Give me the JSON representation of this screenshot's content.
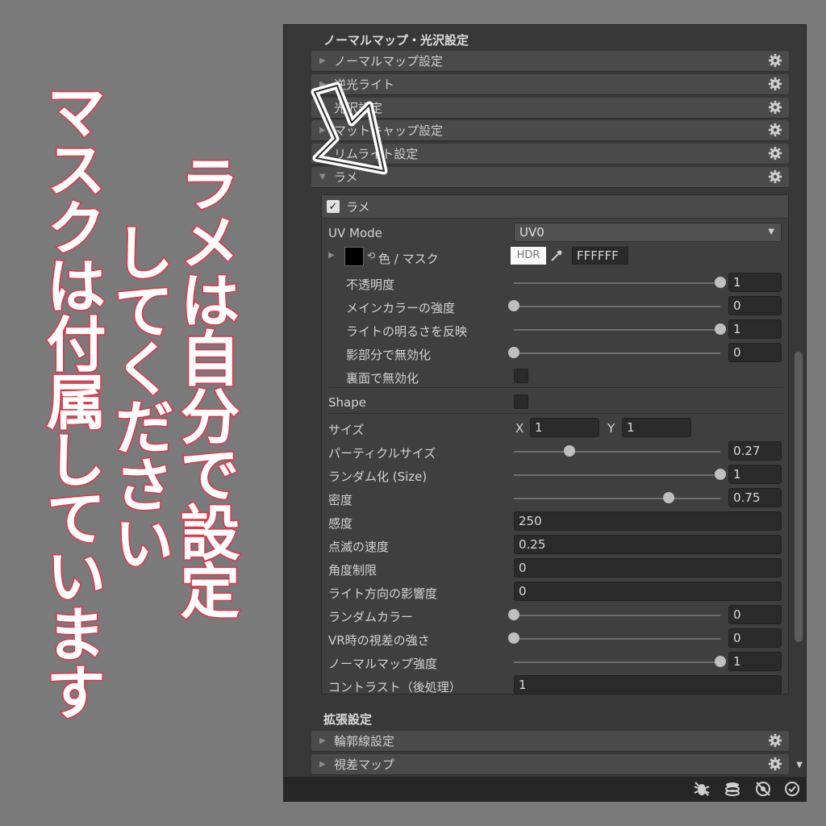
{
  "overlay": {
    "right_text": "ラメは自分で設定",
    "mid_text": "してください",
    "left_text": "マスクは付属しています"
  },
  "panel": {
    "section1_title": "ノーマルマップ・光沢設定",
    "folds_top": [
      {
        "label": "ノーマルマップ設定",
        "expanded": false
      },
      {
        "label": "逆光ライト",
        "expanded": false
      },
      {
        "label": "光沢設定",
        "expanded": false
      },
      {
        "label": "マットキャップ設定",
        "expanded": false
      },
      {
        "label": "リムライト設定",
        "expanded": false
      },
      {
        "label": "ラメ",
        "expanded": true
      }
    ],
    "group": {
      "header_label": "ラメ",
      "uv_mode_label": "UV Mode",
      "uv_mode_value": "UV0",
      "color_label": "色 / マスク",
      "hdr_label": "HDR",
      "color_hex": "FFFFFF",
      "opacity_label": "不透明度",
      "opacity_value": "1",
      "maincolor_label": "メインカラーの強度",
      "maincolor_value": "0",
      "lightbright_label": "ライトの明るさを反映",
      "lightbright_value": "1",
      "shadow_label": "影部分で無効化",
      "shadow_value": "0",
      "backface_label": "裏面で無効化",
      "shape_label": "Shape",
      "size_label": "サイズ",
      "size_x_label": "X",
      "size_x": "1",
      "size_y_label": "Y",
      "size_y": "1",
      "particle_label": "パーティクルサイズ",
      "particle_value": "0.27",
      "random_size_label": "ランダム化 (Size)",
      "random_size_value": "1",
      "density_label": "密度",
      "density_value": "0.75",
      "sensitivity_label": "感度",
      "sensitivity_value": "250",
      "blink_label": "点滅の速度",
      "blink_value": "0.25",
      "angle_label": "角度制限",
      "angle_value": "0",
      "lightdir_label": "ライト方向の影響度",
      "lightdir_value": "0",
      "randomcolor_label": "ランダムカラー",
      "randomcolor_value": "0",
      "vr_label": "VR時の視差の強さ",
      "vr_value": "0",
      "normal_label": "ノーマルマップ強度",
      "normal_value": "1",
      "contrast_label": "コントラスト（後処理）",
      "contrast_value": "1",
      "slider_levels": {
        "opacity": 1,
        "maincolor": 0,
        "lightbright": 1,
        "shadow": 0,
        "particle": 0.27,
        "random_size": 1,
        "density": 0.75,
        "randomcolor": 0,
        "vr": 0,
        "normal": 1
      }
    },
    "section2_title": "拡張設定",
    "folds_bottom": [
      {
        "label": "輪郭線設定"
      },
      {
        "label": "視差マップ"
      }
    ]
  },
  "colors": {
    "panel": "#383838",
    "caption_stroke": "#e8324a"
  }
}
